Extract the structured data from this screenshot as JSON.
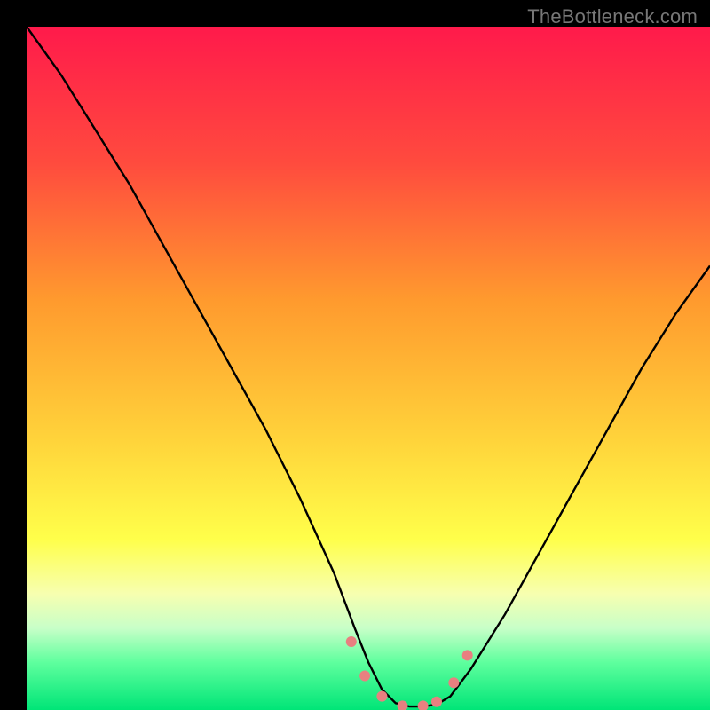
{
  "watermark": "TheBottleneck.com",
  "chart_data": {
    "type": "line",
    "title": "",
    "xlabel": "",
    "ylabel": "",
    "xlim": [
      0,
      100
    ],
    "ylim": [
      0,
      100
    ],
    "background_gradient": {
      "stops": [
        {
          "offset": 0,
          "color": "#ff1a4b"
        },
        {
          "offset": 20,
          "color": "#ff4b3e"
        },
        {
          "offset": 40,
          "color": "#ff9a2e"
        },
        {
          "offset": 60,
          "color": "#ffd23a"
        },
        {
          "offset": 75,
          "color": "#ffff4a"
        },
        {
          "offset": 83,
          "color": "#f7ffb0"
        },
        {
          "offset": 88,
          "color": "#c8ffc8"
        },
        {
          "offset": 93,
          "color": "#5fff9e"
        },
        {
          "offset": 100,
          "color": "#00e577"
        }
      ]
    },
    "series": [
      {
        "name": "bottleneck-curve",
        "x": [
          0,
          5,
          10,
          15,
          20,
          25,
          30,
          35,
          40,
          45,
          48,
          50,
          52,
          54,
          56,
          58,
          60,
          62,
          65,
          70,
          75,
          80,
          85,
          90,
          95,
          100
        ],
        "y": [
          100,
          93,
          85,
          77,
          68,
          59,
          50,
          41,
          31,
          20,
          12,
          7,
          3,
          1,
          0.5,
          0.5,
          0.8,
          2,
          6,
          14,
          23,
          32,
          41,
          50,
          58,
          65
        ],
        "color": "#000000"
      }
    ],
    "marker_points": {
      "color": "#e88080",
      "radius_px": 6,
      "points": [
        {
          "x": 47.5,
          "y": 10
        },
        {
          "x": 49.5,
          "y": 5
        },
        {
          "x": 52,
          "y": 2
        },
        {
          "x": 55,
          "y": 0.6
        },
        {
          "x": 58,
          "y": 0.6
        },
        {
          "x": 60,
          "y": 1.2
        },
        {
          "x": 62.5,
          "y": 4
        },
        {
          "x": 64.5,
          "y": 8
        }
      ]
    }
  }
}
